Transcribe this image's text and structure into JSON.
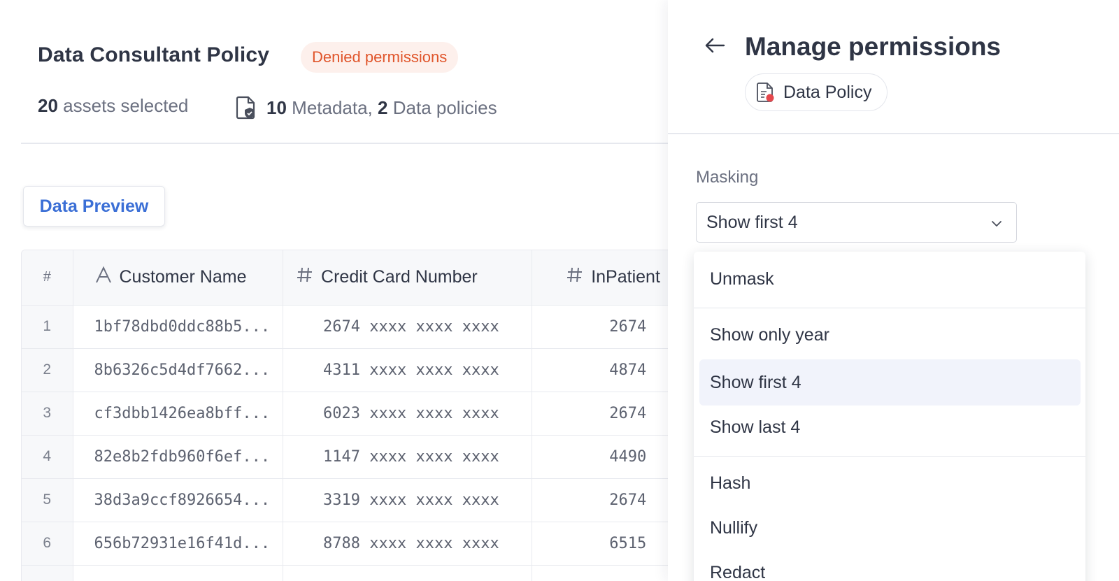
{
  "policy": {
    "title": "Data Consultant Policy",
    "badge": "Denied permissions",
    "assets_count": "20",
    "assets_text": "assets selected",
    "metadata_count": "10",
    "metadata_text": "Metadata,",
    "policies_count": "2",
    "policies_text": "Data policies"
  },
  "tabs": {
    "preview": "Data Preview"
  },
  "table": {
    "headers": {
      "index": "#",
      "name": "Customer Name",
      "cc": "Credit Card Number",
      "inpatient": "InPatient"
    },
    "rows": [
      {
        "index": "1",
        "name": "1bf78dbd0ddc88b5...",
        "cc": "2674 xxxx xxxx xxxx",
        "inpatient": "2674"
      },
      {
        "index": "2",
        "name": "8b6326c5d4df7662...",
        "cc": "4311 xxxx xxxx xxxx",
        "inpatient": "4874"
      },
      {
        "index": "3",
        "name": "cf3dbb1426ea8bff...",
        "cc": "6023 xxxx xxxx xxxx",
        "inpatient": "2674"
      },
      {
        "index": "4",
        "name": "82e8b2fdb960f6ef...",
        "cc": "1147 xxxx xxxx xxxx",
        "inpatient": "4490"
      },
      {
        "index": "5",
        "name": "38d3a9ccf8926654...",
        "cc": "3319 xxxx xxxx xxxx",
        "inpatient": "2674"
      },
      {
        "index": "6",
        "name": "656b72931e16f41d...",
        "cc": "8788 xxxx xxxx xxxx",
        "inpatient": "6515"
      }
    ]
  },
  "panel": {
    "title": "Manage permissions",
    "chip": "Data Policy",
    "masking_label": "Masking",
    "masking_value": "Show first 4",
    "options": [
      "Unmask",
      "Show only year",
      "Show first 4",
      "Show last 4",
      "Hash",
      "Nullify",
      "Redact"
    ]
  },
  "colors": {
    "accent": "#3b6fd6",
    "denied_text": "#e0552b",
    "denied_bg": "#fdf0ec",
    "selected_option_bg": "#f1f3fb"
  },
  "icons": {
    "back": "arrow-left-icon",
    "doc_shield": "document-shield-icon",
    "doc_policy": "document-policy-icon",
    "text_type": "text-type-icon",
    "number_type": "hash-icon",
    "chevron": "chevron-down-icon"
  }
}
